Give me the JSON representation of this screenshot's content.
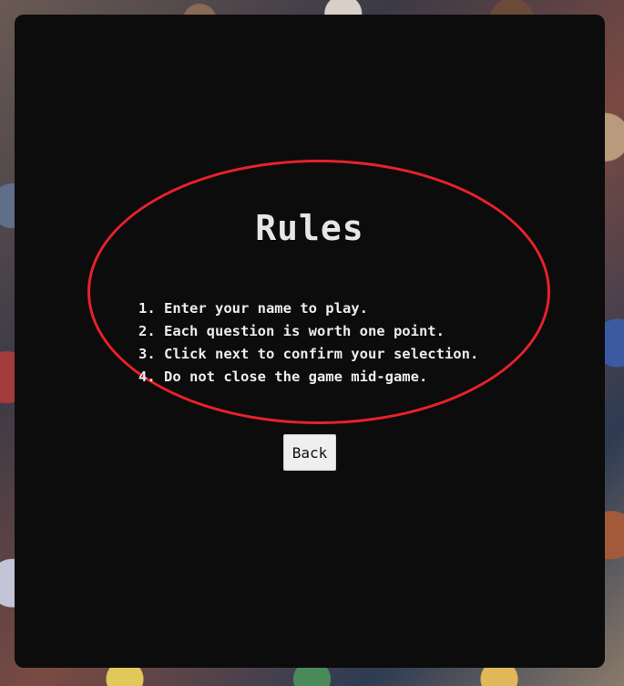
{
  "rules": {
    "title": "Rules",
    "items": [
      "1. Enter your name to play.",
      "2. Each question is worth one point.",
      "3. Click next to confirm your selection.",
      "4. Do not close the game mid-game."
    ]
  },
  "back_button": {
    "label": "Back"
  },
  "colors": {
    "panel": "#0c0c0c",
    "highlight_ellipse": "#e8212b",
    "text": "#ececec",
    "button_bg": "#efefef"
  }
}
